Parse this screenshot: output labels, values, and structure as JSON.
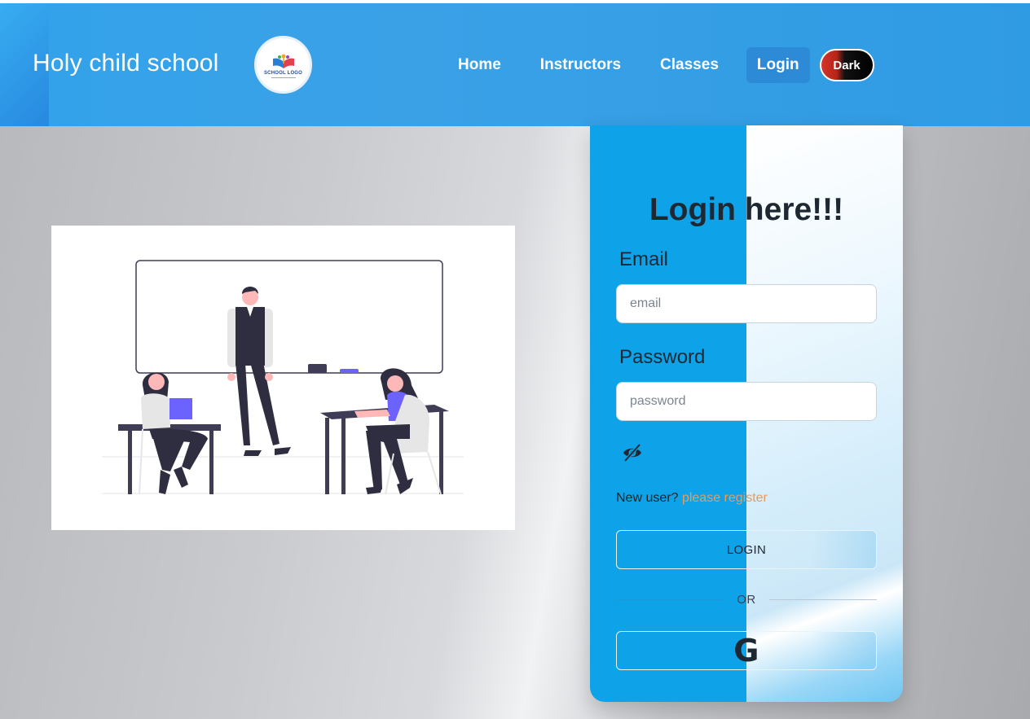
{
  "header": {
    "brand": "Holy child school",
    "logo_text": "SCHOOL LOGO",
    "nav": [
      {
        "label": "Home"
      },
      {
        "label": "Instructors"
      },
      {
        "label": "Classes"
      },
      {
        "label": "Login",
        "active": true
      }
    ],
    "theme_toggle": "Dark"
  },
  "login": {
    "title": "Login here!!!",
    "email_label": "Email",
    "email_placeholder": "email",
    "email_value": "",
    "password_label": "Password",
    "password_placeholder": "password",
    "password_value": "",
    "show_password_icon": "eye-slash-icon",
    "new_user_text": "New user?",
    "register_link": "please register",
    "login_button": "LOGIN",
    "divider": "OR",
    "google_icon": "google-icon",
    "google_glyph": "G"
  },
  "colors": {
    "header_bg": "#33a2ea",
    "card_left": "#0ea3e8",
    "register_link": "#e89b5b",
    "dark_toggle_red": "#d6342b"
  }
}
